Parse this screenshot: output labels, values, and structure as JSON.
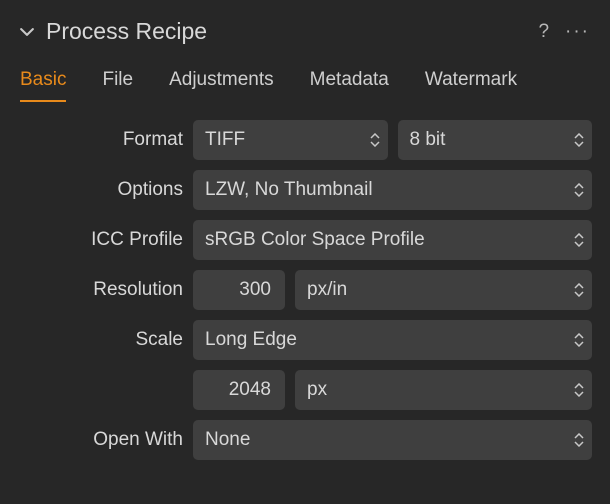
{
  "panel": {
    "title": "Process Recipe"
  },
  "tabs": {
    "basic": "Basic",
    "file": "File",
    "adjustments": "Adjustments",
    "metadata": "Metadata",
    "watermark": "Watermark"
  },
  "labels": {
    "format": "Format",
    "options": "Options",
    "icc": "ICC Profile",
    "resolution": "Resolution",
    "scale": "Scale",
    "openwith": "Open With"
  },
  "values": {
    "format": "TIFF",
    "bitdepth": "8 bit",
    "options": "LZW, No Thumbnail",
    "icc": "sRGB Color Space Profile",
    "resolution": "300",
    "resolution_unit": "px/in",
    "scale_mode": "Long Edge",
    "scale_value": "2048",
    "scale_unit": "px",
    "openwith": "None"
  }
}
